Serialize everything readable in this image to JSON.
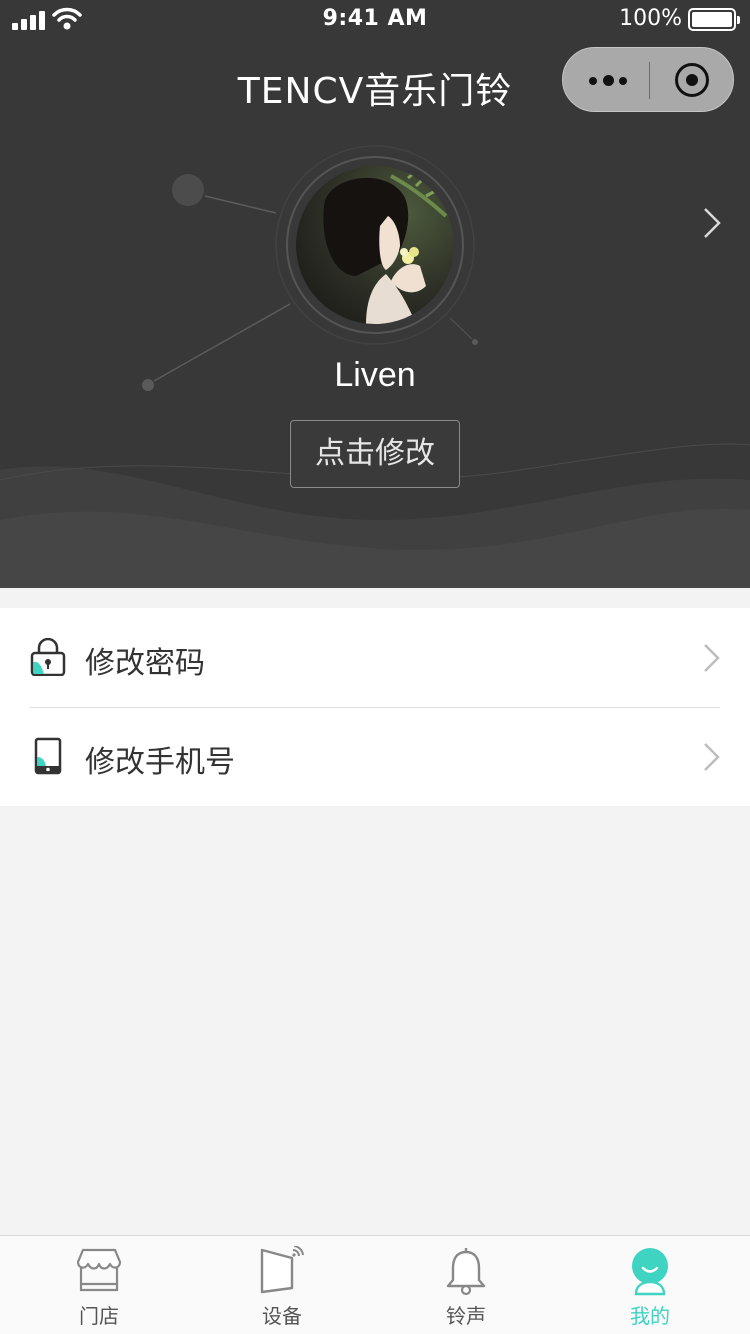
{
  "status_bar": {
    "time": "9:41 AM",
    "battery": "100%"
  },
  "header": {
    "title": "TENCV音乐门铃",
    "capsule_more_icon": "more-dots-icon",
    "capsule_close_icon": "target-close-icon",
    "background_color": "#383838"
  },
  "profile": {
    "username": "Liven",
    "edit_button": "点击修改"
  },
  "menu": {
    "items": [
      {
        "label": "修改密码",
        "icon": "lock-icon"
      },
      {
        "label": "修改手机号",
        "icon": "phone-icon"
      }
    ]
  },
  "tabbar": {
    "accent_color": "#3fd3c2",
    "tabs": [
      {
        "label": "门店",
        "icon": "store-icon",
        "active": false
      },
      {
        "label": "设备",
        "icon": "device-icon",
        "active": false
      },
      {
        "label": "铃声",
        "icon": "bell-icon",
        "active": false
      },
      {
        "label": "我的",
        "icon": "user-icon",
        "active": true
      }
    ]
  }
}
